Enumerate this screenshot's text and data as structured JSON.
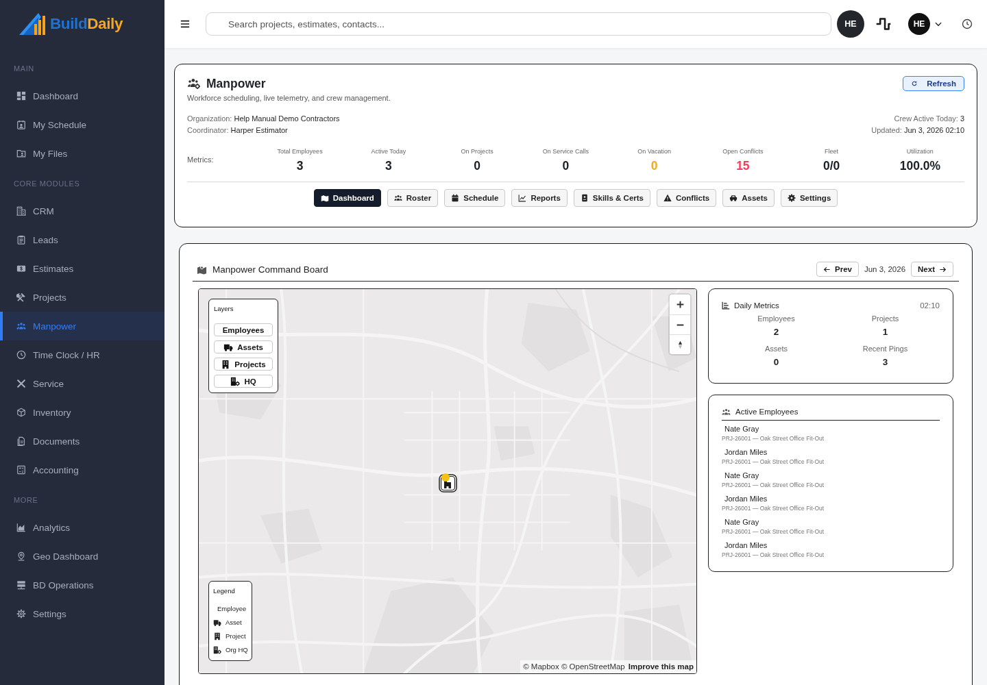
{
  "sidebar": {
    "brand": [
      "Build",
      "Daily"
    ],
    "sections": [
      {
        "title": "MAIN",
        "items": [
          {
            "label": "Dashboard",
            "selected": false
          },
          {
            "label": "My Schedule",
            "selected": false
          },
          {
            "label": "My Files",
            "selected": false
          }
        ]
      },
      {
        "title": "CORE MODULES",
        "items": [
          {
            "label": "CRM",
            "selected": false
          },
          {
            "label": "Leads",
            "selected": false
          },
          {
            "label": "Estimates",
            "selected": false
          },
          {
            "label": "Projects",
            "selected": false
          },
          {
            "label": "Manpower",
            "selected": true
          },
          {
            "label": "Time Clock / HR",
            "selected": false
          },
          {
            "label": "Service",
            "selected": false
          },
          {
            "label": "Inventory",
            "selected": false
          },
          {
            "label": "Documents",
            "selected": false
          },
          {
            "label": "Accounting",
            "selected": false
          }
        ]
      },
      {
        "title": "MORE",
        "items": [
          {
            "label": "Analytics",
            "selected": false
          },
          {
            "label": "Geo Dashboard",
            "selected": false
          },
          {
            "label": "BD Operations",
            "selected": false
          },
          {
            "label": "Settings",
            "selected": false
          }
        ]
      }
    ]
  },
  "topbar": {
    "search": {
      "placeholder": "Search projects, estimates, contacts..."
    },
    "avatars": [
      "HE",
      "HE"
    ]
  },
  "header": {
    "title": "Manpower",
    "subtitle": "Workforce scheduling, live telemetry, and crew management.",
    "refresh": "Refresh",
    "details": [
      {
        "label": "Organization:",
        "value": "Help Manual Demo Contractors"
      },
      {
        "label": "Coordinator:",
        "value": "Harper Estimator"
      }
    ],
    "summary": [
      {
        "label": "Crew Active Today:",
        "value": "3"
      },
      {
        "label": "Updated:",
        "value": "Jun 3, 2026 02:10"
      }
    ],
    "metrics_label": "Metrics:",
    "metrics": [
      {
        "label": "Total Employees",
        "value": "3",
        "color": "#1b1f27"
      },
      {
        "label": "Active Today",
        "value": "3",
        "color": "#1b1f27"
      },
      {
        "label": "On Projects",
        "value": "0",
        "color": "#1b1f27"
      },
      {
        "label": "On Service Calls",
        "value": "0",
        "color": "#1b1f27"
      },
      {
        "label": "On Vacation",
        "value": "0",
        "color": "#f5a623"
      },
      {
        "label": "Open Conflicts",
        "value": "15",
        "color": "#f43f5e"
      },
      {
        "label": "Fleet",
        "value": "0/0",
        "color": "#1b1f27"
      },
      {
        "label": "Utilization",
        "value": "100.0%",
        "color": "#1b1f27"
      }
    ],
    "tabs": [
      {
        "label": "Dashboard",
        "selected": true
      },
      {
        "label": "Roster",
        "selected": false
      },
      {
        "label": "Schedule",
        "selected": false
      },
      {
        "label": "Reports",
        "selected": false
      },
      {
        "label": "Skills & Certs",
        "selected": false
      },
      {
        "label": "Conflicts",
        "selected": false
      },
      {
        "label": "Assets",
        "selected": false
      },
      {
        "label": "Settings",
        "selected": false
      }
    ]
  },
  "board": {
    "title": "Manpower Command Board",
    "prev": "Prev",
    "date": "Jun 3, 2026",
    "next": "Next",
    "map": {
      "layers_title": "Layers",
      "layers": [
        "Employees",
        "Assets",
        "Projects",
        "HQ"
      ],
      "legend_title": "Legend",
      "legend": [
        "Employee",
        "Asset",
        "Project",
        "Org HQ"
      ],
      "attribution": "© Mapbox © OpenStreetMap",
      "improve_link": "Improve this map"
    },
    "daily_metrics": {
      "title": "Daily Metrics",
      "time": "02:10",
      "stats": [
        {
          "label": "Employees",
          "value": "2"
        },
        {
          "label": "Projects",
          "value": "1"
        },
        {
          "label": "Assets",
          "value": "0"
        },
        {
          "label": "Recent Pings",
          "value": "3"
        }
      ]
    },
    "active_employees": {
      "title": "Active Employees",
      "items": [
        {
          "name": "Nate Gray",
          "detail": "PRJ-26001 — Oak Street Office Fit-Out"
        },
        {
          "name": "Jordan Miles",
          "detail": "PRJ-26001 — Oak Street Office Fit-Out"
        },
        {
          "name": "Nate Gray",
          "detail": "PRJ-26001 — Oak Street Office Fit-Out"
        },
        {
          "name": "Jordan Miles",
          "detail": "PRJ-26001 — Oak Street Office Fit-Out"
        },
        {
          "name": "Nate Gray",
          "detail": "PRJ-26001 — Oak Street Office Fit-Out"
        },
        {
          "name": "Jordan Miles",
          "detail": "PRJ-26001 — Oak Street Office Fit-Out"
        }
      ]
    }
  }
}
